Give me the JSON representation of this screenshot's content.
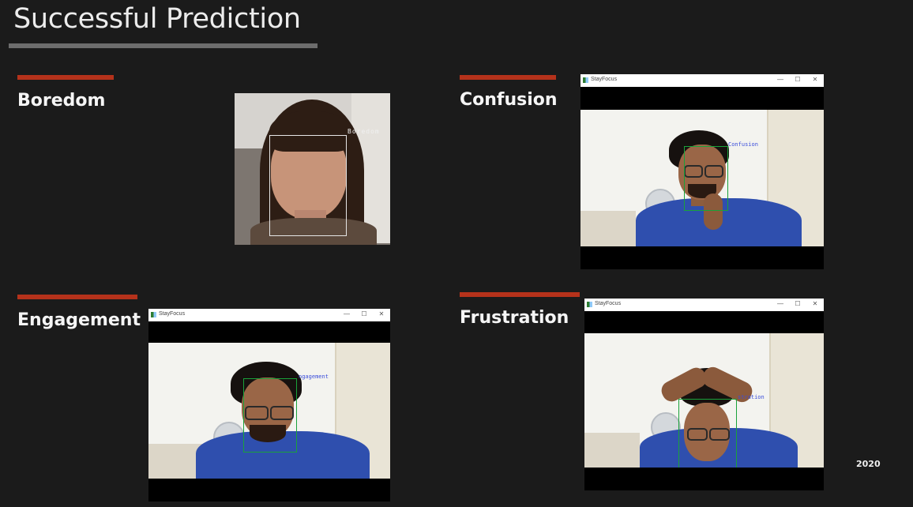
{
  "slide": {
    "title": "Successful Prediction",
    "year": "2020",
    "accent_color": "#b5321b"
  },
  "panels": {
    "boredom": {
      "label": "Boredom",
      "prediction": "Boredom"
    },
    "confusion": {
      "label": "Confusion",
      "prediction": "Confusion",
      "app_name": "StayFocus"
    },
    "engagement": {
      "label": "Engagement",
      "prediction": "ngagement",
      "app_name": "StayFocus"
    },
    "frustration": {
      "label": "Frustration",
      "prediction": "stration",
      "app_name": "StayFocus"
    }
  },
  "window_controls": {
    "minimize": "—",
    "maximize": "☐",
    "close": "✕"
  }
}
